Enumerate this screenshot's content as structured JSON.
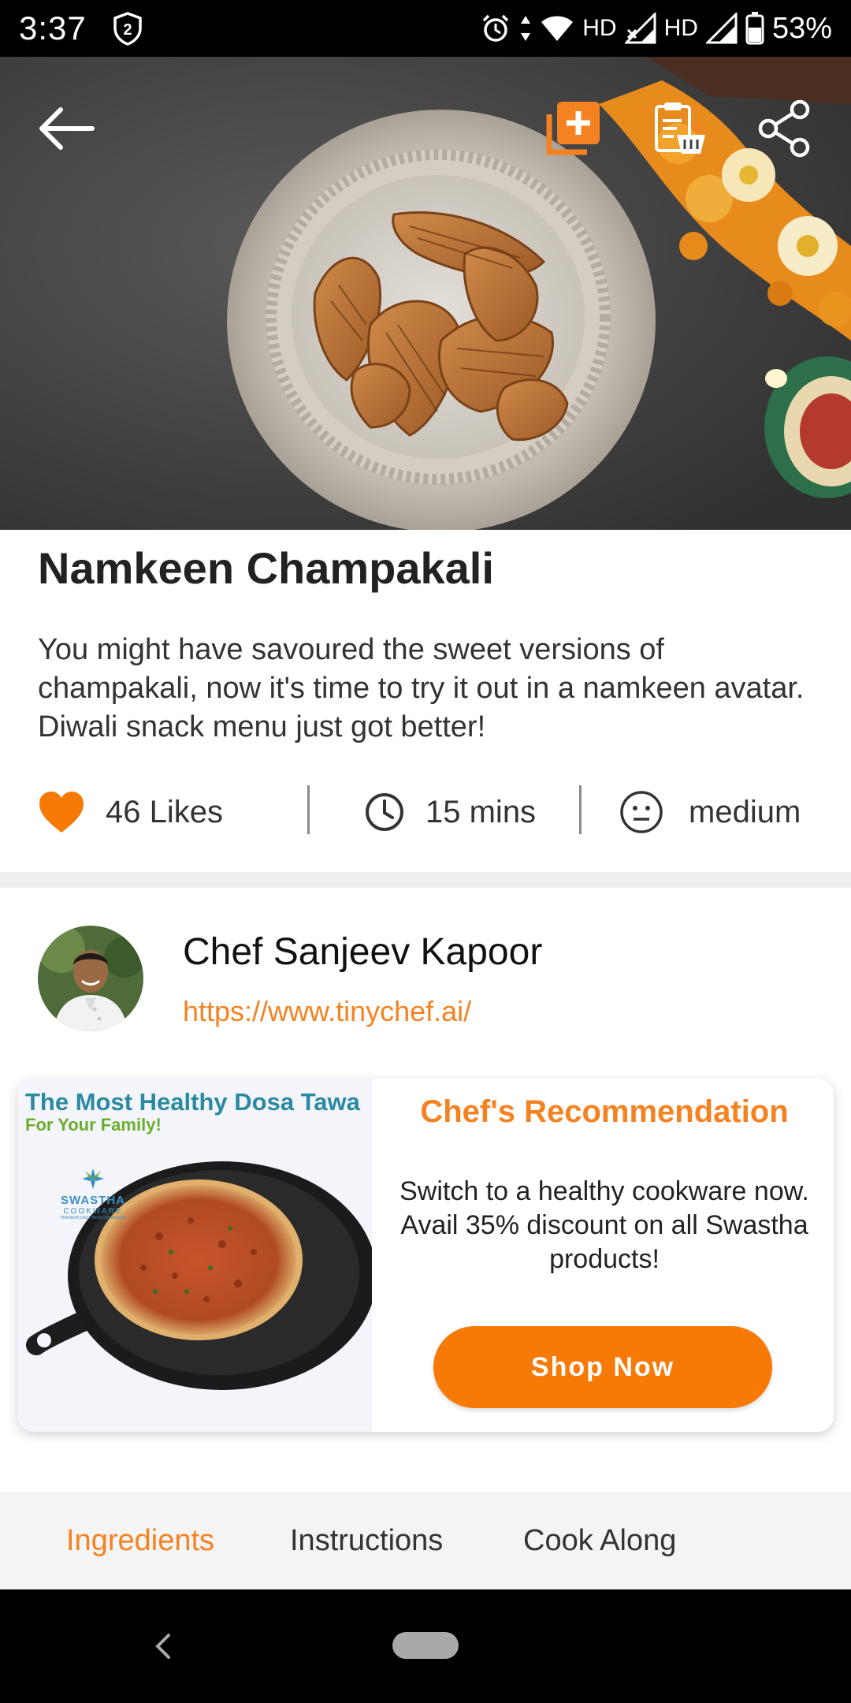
{
  "status_bar": {
    "time": "3:37",
    "notification_count": "2",
    "network_label_1": "HD",
    "network_label_2": "HD",
    "battery": "53%"
  },
  "hero": {
    "back_icon": "arrow-left-icon",
    "actions": [
      "add-to-collection-icon",
      "recipe-shopping-list-icon",
      "share-icon"
    ],
    "accent_color": "#f58220"
  },
  "recipe": {
    "title": "Namkeen Champakali",
    "description": "You might have savoured the sweet versions of champakali, now it's time to try it out in a namkeen avatar. Diwali snack menu just got better!",
    "likes": "46 Likes",
    "time": "15 mins",
    "difficulty": "medium"
  },
  "chef": {
    "name": "Chef Sanjeev Kapoor",
    "link": "https://www.tinychef.ai/"
  },
  "recommendation": {
    "ad_title": "The Most Healthy Dosa Tawa",
    "ad_subtitle": "For Your Family!",
    "ad_brand": "SWASTHA",
    "ad_brand_sub": "COOKWARE",
    "ad_brand_tagline": "PREMIUM CAST IRON COOKWARE",
    "title": "Chef's Recommendation",
    "text": "Switch to a healthy cookware now. Avail 35% discount on all Swastha products!",
    "button": "Shop Now"
  },
  "tabs": [
    {
      "label": "Ingredients",
      "active": true
    },
    {
      "label": "Instructions",
      "active": false
    },
    {
      "label": "Cook Along",
      "active": false
    }
  ],
  "colors": {
    "accent": "#f58220",
    "button": "#f77a07",
    "heart": "#f77a07"
  }
}
